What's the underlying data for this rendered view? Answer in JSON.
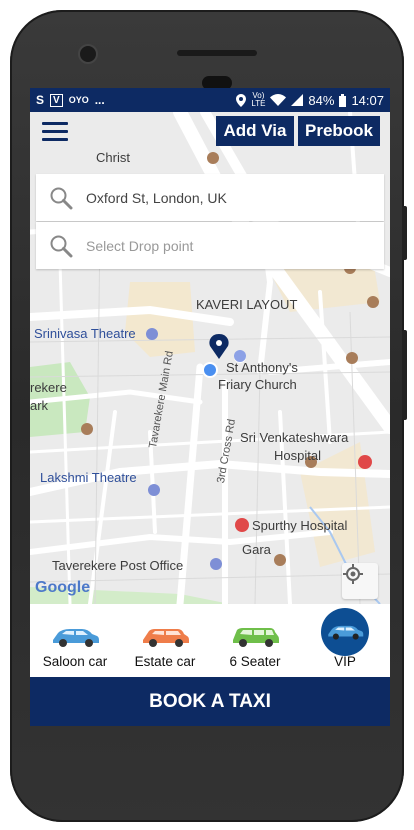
{
  "status_bar": {
    "left_icons": [
      "S",
      "V",
      "OYO",
      "..."
    ],
    "battery": "84%",
    "time": "14:07"
  },
  "header": {
    "add_via_label": "Add Via",
    "prebook_label": "Prebook"
  },
  "search": {
    "pickup_value": "Oxford St, London, UK",
    "drop_placeholder": "Select Drop point"
  },
  "map": {
    "labels": {
      "christ": "Christ",
      "kaveri": "KAVERI LAYOUT",
      "srinivasa": "Srinivasa Theatre",
      "st_anthony_1": "St Anthony's",
      "st_anthony_2": "Friary Church",
      "rekere": "rekere",
      "ark": "ark",
      "sri_venkat_1": "Sri Venkateshwara",
      "sri_venkat_2": "Hospital",
      "tavarekere_main": "Tavarekere Main Rd",
      "cross3": "3rd Cross Rd",
      "lakshmi": "Lakshmi Theatre",
      "spurthy": "Spurthy Hospital",
      "gara": "Gara",
      "post_office": "Taverekere Post Office",
      "google": "Google"
    }
  },
  "vehicles": [
    {
      "label": "Saloon car",
      "color": "#4a9bd9"
    },
    {
      "label": "Estate car",
      "color": "#ef7d4a"
    },
    {
      "label": "6 Seater",
      "color": "#6fbf4a"
    },
    {
      "label": "VIP",
      "color": "#4a9bd9"
    }
  ],
  "book_button": "BOOK A TAXI",
  "colors": {
    "brand": "#0d2a63",
    "vip_circle": "#0d4e93"
  }
}
